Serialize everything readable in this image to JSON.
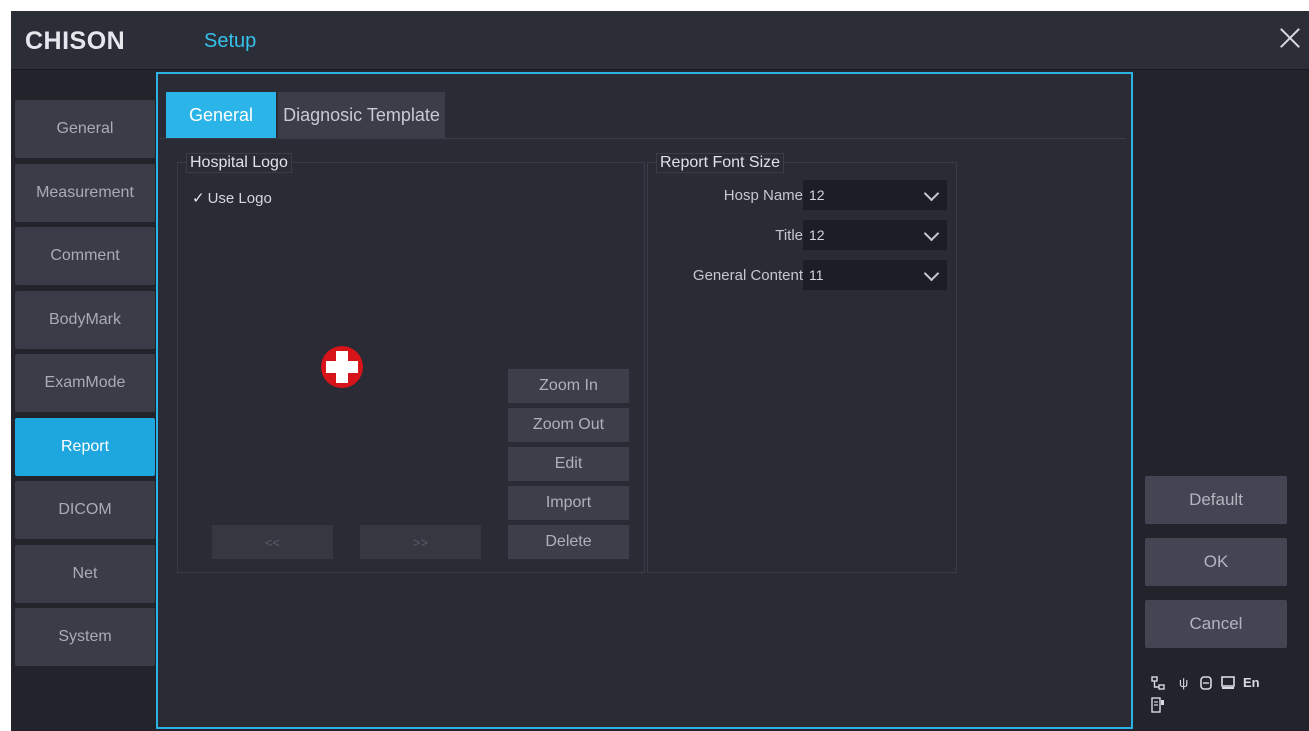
{
  "header": {
    "brand": "CHISON",
    "title": "Setup",
    "close_icon": "close-icon"
  },
  "sidebar": {
    "items": [
      {
        "label": "General"
      },
      {
        "label": "Measurement"
      },
      {
        "label": "Comment"
      },
      {
        "label": "BodyMark"
      },
      {
        "label": "ExamMode"
      },
      {
        "label": "Report"
      },
      {
        "label": "DICOM"
      },
      {
        "label": "Net"
      },
      {
        "label": "System"
      }
    ],
    "active": "Report"
  },
  "tabs": [
    {
      "label": "General"
    },
    {
      "label": "Diagnosic Template"
    }
  ],
  "hospital_logo": {
    "title": "Hospital Logo",
    "use_logo_label": "Use Logo",
    "use_logo_checked": true,
    "buttons": {
      "zoom_in": "Zoom In",
      "zoom_out": "Zoom Out",
      "edit": "Edit",
      "import": "Import",
      "delete": "Delete"
    },
    "prev": "<<",
    "next": ">>"
  },
  "report_font": {
    "title": "Report Font Size",
    "rows": [
      {
        "label": "Hosp Name",
        "value": "12"
      },
      {
        "label": "Title",
        "value": "12"
      },
      {
        "label": "General Content",
        "value": "11"
      }
    ]
  },
  "actions": {
    "default": "Default",
    "ok": "OK",
    "cancel": "Cancel"
  },
  "status_bar": {
    "lang": "En",
    "icons": [
      "network-icon",
      "usb-icon",
      "storage-icon",
      "monitor-icon",
      "printer-icon"
    ]
  },
  "colors": {
    "accent": "#1ea6de",
    "background": "#22232b",
    "panel_border": "#2ab3e4",
    "logo_cross": "#d7141a"
  }
}
